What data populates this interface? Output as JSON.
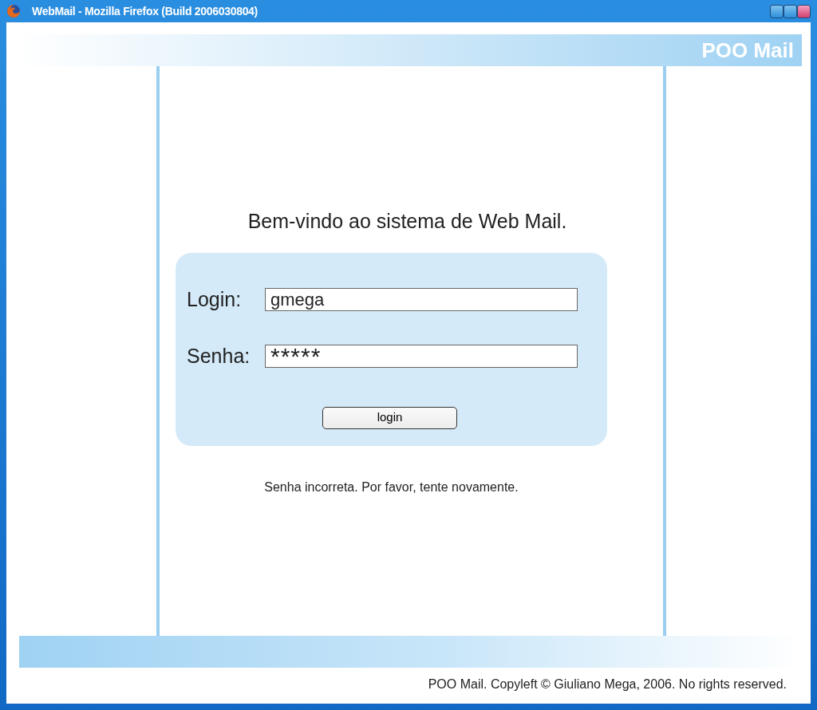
{
  "window": {
    "title": "WebMail - Mozilla Firefox (Build 2006030804)"
  },
  "header": {
    "brand": "POO Mail"
  },
  "welcome": "Bem-vindo ao sistema de Web Mail.",
  "form": {
    "fields": [
      {
        "label": "Login:",
        "value": "gmega",
        "kind": "text"
      },
      {
        "label": "Senha:",
        "value": "*****",
        "kind": "password"
      }
    ],
    "button": "login"
  },
  "error": "Senha incorreta. Por favor, tente novamente.",
  "footer": "POO Mail. Copyleft © Giuliano Mega, 2006. No rights reserved."
}
